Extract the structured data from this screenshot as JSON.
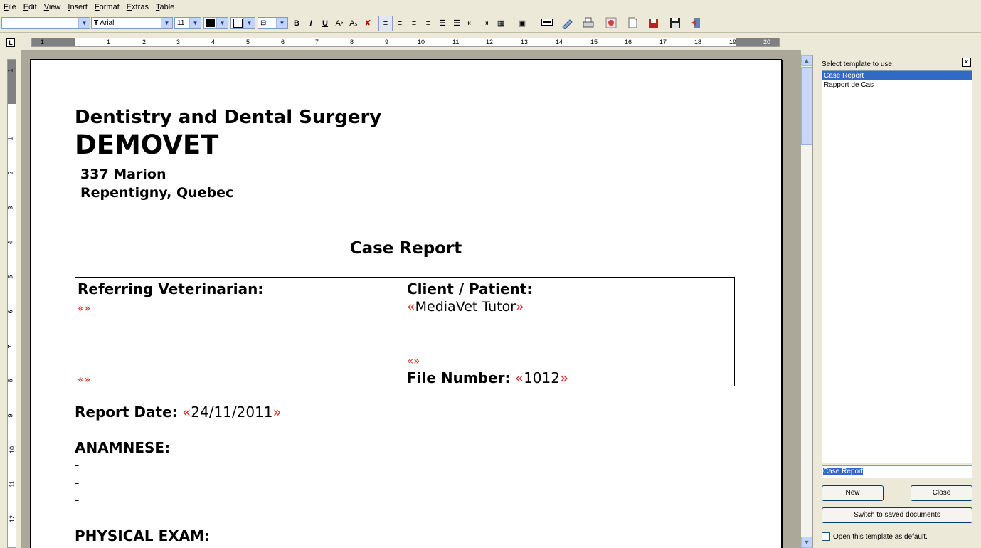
{
  "menu": [
    "File",
    "Edit",
    "View",
    "Insert",
    "Format",
    "Extras",
    "Table"
  ],
  "toolbar": {
    "font_name": "Arial",
    "font_size": "11",
    "buttons": [
      "B",
      "I",
      "U",
      "Aˢ",
      "Aₛ",
      "✘",
      "≡",
      "≡",
      "≡",
      "≡",
      "☰",
      "☰",
      "⇤",
      "⇥",
      "▦",
      "▣"
    ]
  },
  "ruler": {
    "h_numbers": [
      "1",
      "1",
      "2",
      "3",
      "4",
      "5",
      "6",
      "7",
      "8",
      "9",
      "10",
      "11",
      "12",
      "13",
      "14",
      "15",
      "16",
      "17",
      "18",
      "19",
      "20"
    ],
    "v_numbers": [
      "1",
      "1",
      "2",
      "3",
      "4",
      "5",
      "6",
      "7",
      "8",
      "9",
      "10",
      "11",
      "12"
    ],
    "tab_glyph": "L"
  },
  "document": {
    "heading1": "Dentistry and Dental Surgery",
    "heading2": "DEMOVET",
    "address1": "337 Marion",
    "address2": "Repentigny, Quebec",
    "report_title": "Case Report",
    "table": {
      "left_header": "Referring Veterinarian:",
      "left_field1": "«»",
      "left_field2": "«»",
      "right_header": "Client / Patient:",
      "client_open": "«",
      "client_value": "MediaVet Tutor",
      "client_close": "»",
      "right_field": "«»",
      "file_label": "File Number:",
      "file_open": "«",
      "file_value": "1012",
      "file_close": "»"
    },
    "report_date_label": "Report Date:",
    "report_date_open": "«",
    "report_date_value": "24/11/2011",
    "report_date_close": "»",
    "anamnese_label": "ANAMNESE:",
    "dashes": [
      "-",
      "-",
      "-"
    ],
    "physical_exam_label": "PHYSICAL EXAM:"
  },
  "template_panel": {
    "label": "Select template to use:",
    "close_glyph": "×",
    "templates": [
      "Case Report",
      "Rapport de Cas"
    ],
    "selected_index": 0,
    "name_value": "Case Report",
    "new_label": "New",
    "close_label": "Close",
    "switch_label": "Switch to saved documents",
    "default_label": "Open this template as default."
  },
  "colors": {
    "merge_marker": "#e03030",
    "selection": "#316ac5"
  }
}
